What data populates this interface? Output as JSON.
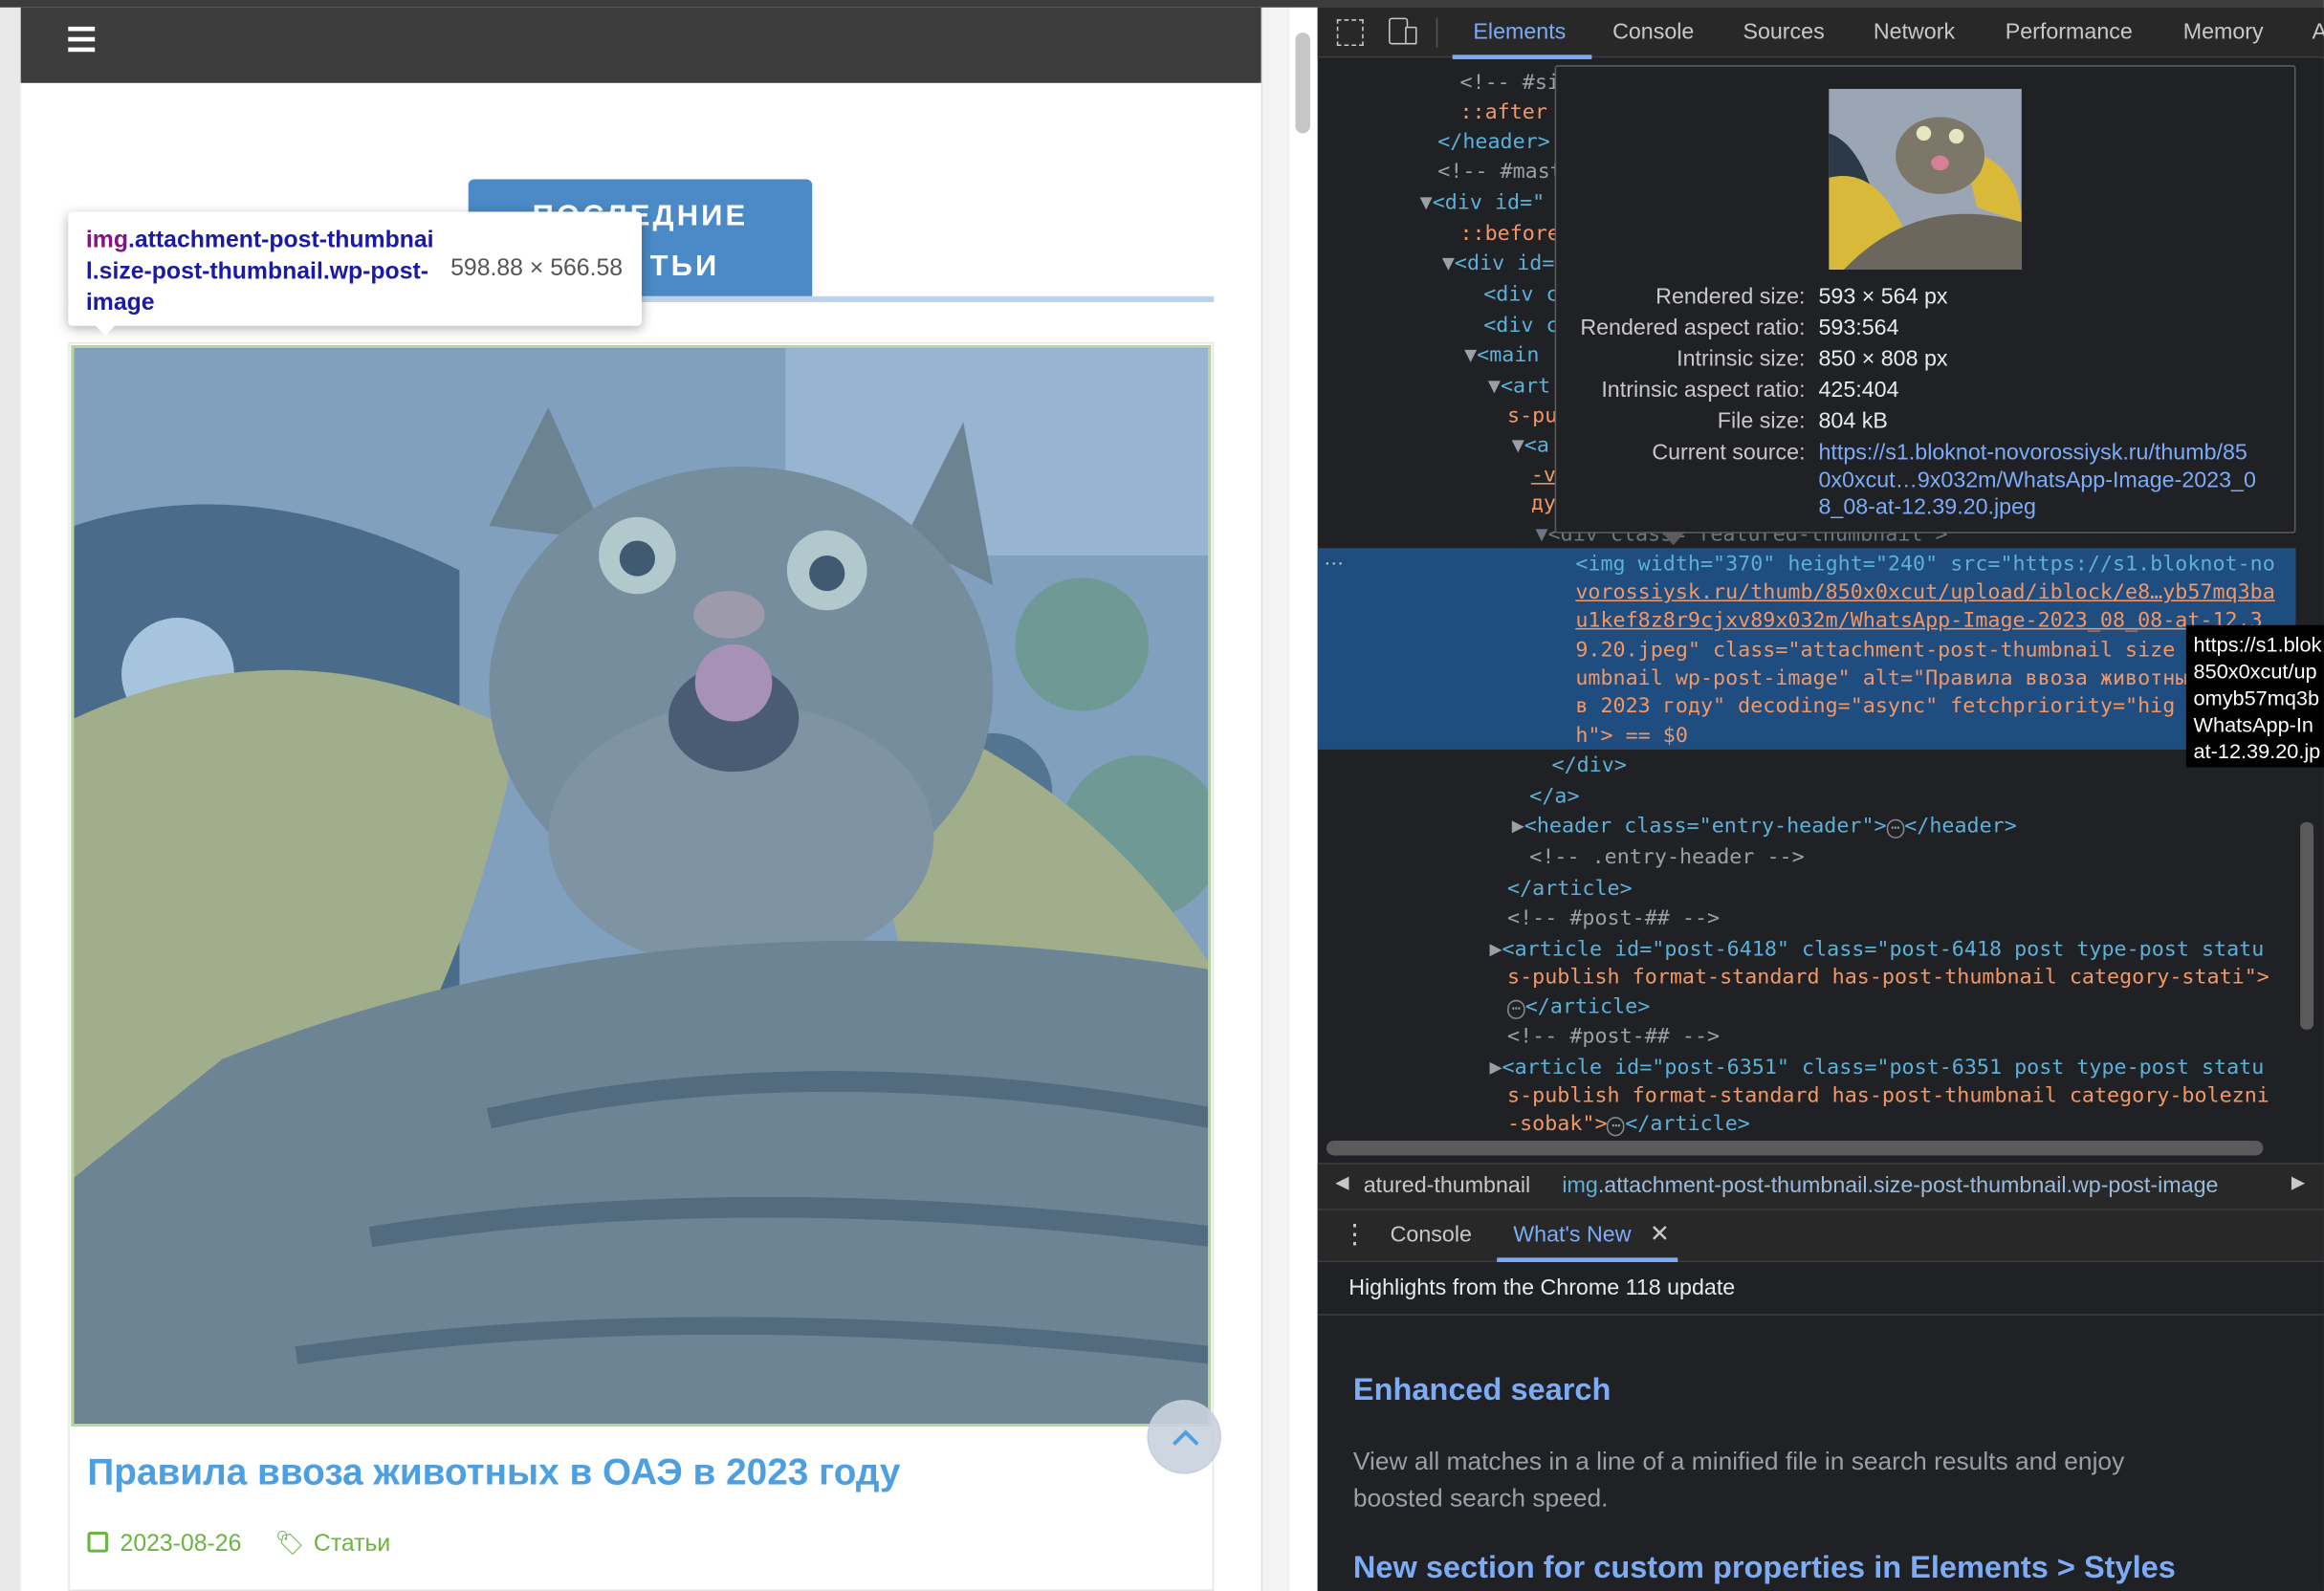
{
  "page": {
    "section_tab_line1": "ПОСЛЕДНИЕ",
    "section_tab_line2": "ТЬИ",
    "post_title": "Правила ввоза животных в ОАЭ в 2023 году",
    "post_date": "2023-08-26",
    "post_category": "Статьи"
  },
  "highlight_tooltip": {
    "tag": "img",
    "selector": ".attachment-post-thumbnail.size-post-thumbnail.wp-post-image",
    "size": "598.88 × 566.58"
  },
  "devtools": {
    "tabs": [
      "Elements",
      "Console",
      "Sources",
      "Network",
      "Performance",
      "Memory",
      "A"
    ],
    "active_tab": "Elements",
    "dom_lines": {
      "l1": "<!-- #si",
      "l2": "::after",
      "l3": "</header>",
      "l4": "<!-- #mast",
      "l5a": "<div id=\"",
      "l6": "::before",
      "l7": "<div id=",
      "l8": "<div c",
      "l9": "<div c",
      "l10": "<main",
      "l11": "<art",
      "l12": "s-pu",
      "l13": "<a",
      "l14": "-v",
      "l15": "ду",
      "l16": "<div class=\"featured-thumbnail\">",
      "img1": "<img width=\"370\" height=\"240\" src=\"https://s1.bloknot-no",
      "img2": "vorossiysk.ru/thumb/850x0xcut/upload/iblock/e8…yb57mq3ba",
      "img3": "u1kef8z8r9cjxv89x032m/WhatsApp-Image-2023_08_08-at-12.3",
      "img4": "9.20.jpeg\" class=\"attachment-post-thumbnail size",
      "img5": "umbnail wp-post-image\" alt=\"Правила ввоза животны",
      "img6": "в 2023 году\" decoding=\"async\" fetchpriority=\"hig",
      "img7": "h\"> == $0",
      "c1": "</div>",
      "c2": "</a>",
      "c3": "<header class=\"entry-header\">",
      "c3b": "</header>",
      "c4": "<!-- .entry-header -->",
      "c5": "</article>",
      "c6": "<!-- #post-## -->",
      "c7": "<article id=\"post-6418\" class=\"post-6418 post type-post statu",
      "c8": "s-publish format-standard has-post-thumbnail category-stati\">",
      "c9": "</article>",
      "c10": "<!-- #post-## -->",
      "c11": "<article id=\"post-6351\" class=\"post-6351 post type-post statu",
      "c12": "s-publish format-standard has-post-thumbnail category-bolezni",
      "c13": "-sobak\">",
      "c13b": "</article>",
      "dots": "…"
    },
    "inspector": {
      "rendered_size_label": "Rendered size:",
      "rendered_size": "593 × 564 px",
      "rendered_ratio_label": "Rendered aspect ratio:",
      "rendered_ratio": "593:564",
      "intrinsic_size_label": "Intrinsic size:",
      "intrinsic_size": "850 × 808 px",
      "intrinsic_ratio_label": "Intrinsic aspect ratio:",
      "intrinsic_ratio": "425:404",
      "file_size_label": "File size:",
      "file_size": "804 kB",
      "current_source_label": "Current source:",
      "current_source_1": "https://s1.bloknot-novorossiysk.ru/thumb/85",
      "current_source_2": "0x0xcut…9x032m/WhatsApp-Image-2023_0",
      "current_source_3": "8_08-at-12.39.20.jpeg"
    },
    "url_tooltip": "https://s1.blok\n850x0xcut/up\nomyb57mq3b\nWhatsApp-In\nat-12.39.20.jp",
    "breadcrumbs": {
      "prev": "atured-thumbnail",
      "current_tag": "img",
      "current_sel": ".attachment-post-thumbnail.size-post-thumbnail.wp-post-image"
    },
    "drawer": {
      "tab_console": "Console",
      "tab_whatsnew": "What's New",
      "highlights": "Highlights from the Chrome 118 update",
      "h1": "Enhanced search",
      "p1a": "View all matches in a line of a minified file in search results and enjoy",
      "p1b": "boosted search speed.",
      "h2": "New section for custom properties in Elements > Styles"
    }
  }
}
